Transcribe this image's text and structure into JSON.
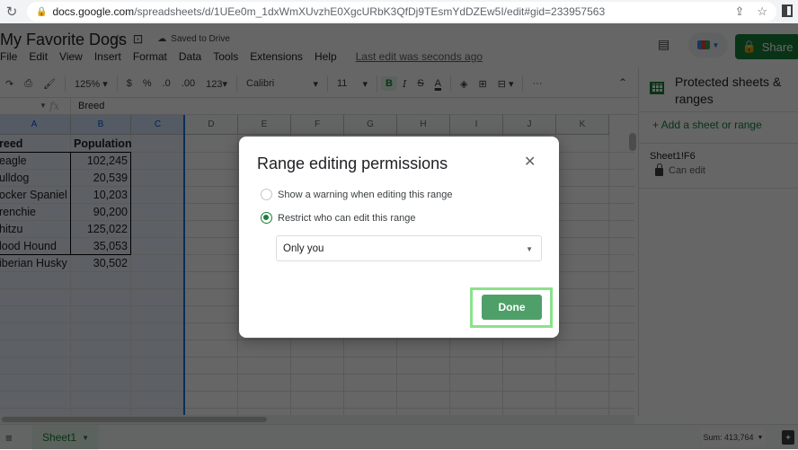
{
  "browser": {
    "url_domain": "docs.google.com",
    "url_path": "/spreadsheets/d/1UEe0m_1dxWmXUvzhE0XgcURbK3QfDj9TEsmYdDZEw5I/edit#gid=233957563",
    "icons": [
      "reload-icon",
      "lock-icon",
      "share-page-icon",
      "bookmark-star-icon",
      "side-panel-icon"
    ]
  },
  "header": {
    "doc_title": "My Favorite Dogs",
    "saved_status": "Saved to Drive",
    "share_label": "Share",
    "last_edit": "Last edit was seconds ago"
  },
  "menu": [
    "File",
    "Edit",
    "View",
    "Insert",
    "Format",
    "Data",
    "Tools",
    "Extensions",
    "Help"
  ],
  "toolbar": {
    "zoom": "125%",
    "currency": "$",
    "percent": "%",
    "decrease_decimal": ".0",
    "increase_decimal": ".00",
    "more_formats": "123",
    "font": "Calibri",
    "font_size": "11",
    "bold": "B",
    "italic": "I",
    "strikethrough": "S",
    "text_color": "A",
    "more": "···"
  },
  "formula_bar": {
    "fx": "fx",
    "value": "Breed"
  },
  "grid": {
    "columns": [
      "A",
      "B",
      "C",
      "D",
      "E",
      "F",
      "G",
      "H",
      "I",
      "J",
      "K"
    ],
    "selected_columns": [
      "A",
      "B",
      "C"
    ],
    "header_row": [
      "reed",
      "Population"
    ],
    "rows": [
      [
        "eagle",
        "102,245"
      ],
      [
        "ulldog",
        "20,539"
      ],
      [
        "ocker Spaniel",
        "10,203"
      ],
      [
        "renchie",
        "90,200"
      ],
      [
        "hitzu",
        "125,022"
      ],
      [
        "lood Hound",
        "35,053"
      ],
      [
        "iberian Husky",
        "30,502"
      ]
    ]
  },
  "side_panel": {
    "title": "Protected sheets & ranges",
    "add_label": "+ Add a sheet or range",
    "range": "Sheet1!F6",
    "permission": "Can edit"
  },
  "bottom": {
    "sheet_tab": "Sheet1",
    "sum": "Sum: 413,764"
  },
  "dialog": {
    "title": "Range editing permissions",
    "options": [
      {
        "label": "Show a warning when editing this range",
        "selected": false
      },
      {
        "label": "Restrict who can edit this range",
        "selected": true
      }
    ],
    "select_value": "Only you",
    "done_label": "Done",
    "accent_color": "#188038"
  }
}
